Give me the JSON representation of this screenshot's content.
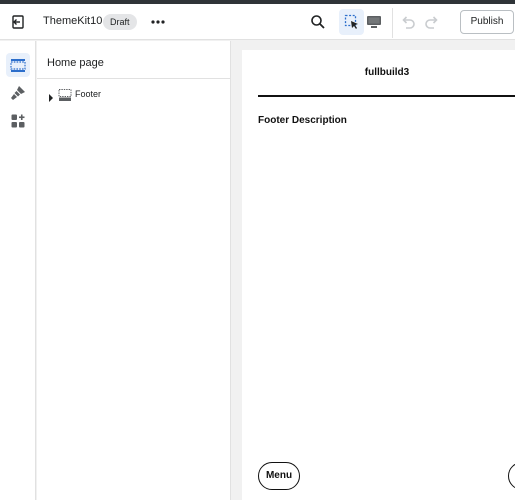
{
  "topbar": {
    "exit_icon": "exit-icon",
    "theme_name": "ThemeKit10",
    "status_badge": "Draft",
    "more_icon": "ellipsis-icon",
    "search_icon": "search-icon",
    "inspector_icon": "inspector-cursor-icon",
    "preview_icon": "desktop-icon",
    "undo_icon": "undo-icon",
    "redo_icon": "redo-icon",
    "publish_label": "Publish"
  },
  "leftrail": {
    "items": [
      {
        "icon": "sections-icon",
        "active": true
      },
      {
        "icon": "theme-settings-brush-icon",
        "active": false
      },
      {
        "icon": "apps-blocks-icon",
        "active": false
      }
    ]
  },
  "sidebar": {
    "heading": "Home page",
    "tree": [
      {
        "label": "Footer",
        "icon": "section-footer-icon",
        "expanded": false
      }
    ]
  },
  "preview": {
    "store_name": "fullbuild3",
    "footer_description": "Footer Description",
    "menu_label": "Menu"
  },
  "colors": {
    "accent": "#2c6ecb",
    "active_bg": "#e8f0fb",
    "text": "#202223",
    "border": "#e1e1e1"
  }
}
